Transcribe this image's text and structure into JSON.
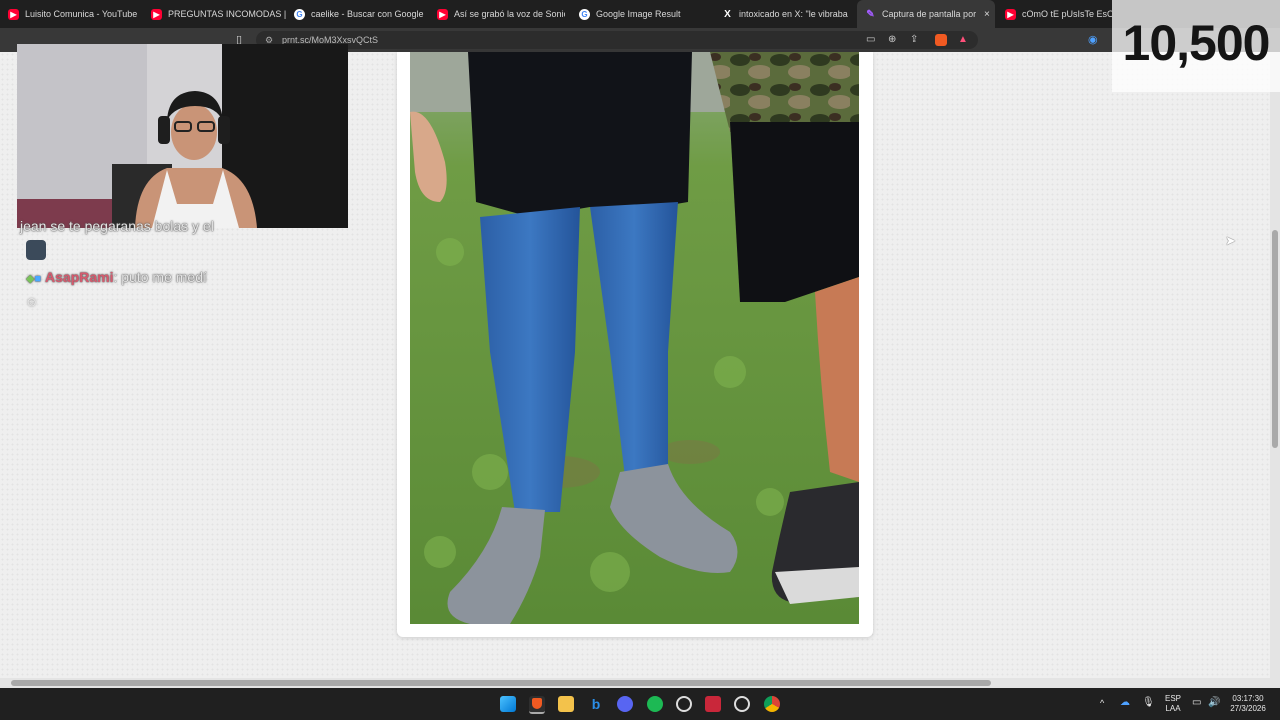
{
  "tabs": [
    {
      "title": "Luisito Comunica - YouTube",
      "icon": "youtube-icon",
      "color": "#ff0033"
    },
    {
      "title": "PREGUNTAS INCOMODAS | De",
      "icon": "youtube-icon",
      "color": "#ff0033"
    },
    {
      "title": "caelike - Buscar con Google",
      "icon": "google-icon",
      "color": "#ffffff"
    },
    {
      "title": "Así se grabó la voz de Sonic pa",
      "icon": "youtube-icon",
      "color": "#ff0033"
    },
    {
      "title": "Google Image Result",
      "icon": "google-icon",
      "color": "#ffffff"
    },
    {
      "title": "intoxicado en X: \"le vibraba un",
      "icon": "x-icon",
      "color": "#000000"
    },
    {
      "title": "Captura de pantalla por Li",
      "icon": "feather-icon",
      "color": "#a35cff"
    },
    {
      "title": "cOmO tE pUsIsTe EsOs Je",
      "icon": "youtube-icon",
      "color": "#ff0033"
    }
  ],
  "tab_close_glyph": "×",
  "address_bar": {
    "url": "prnt.sc/MoM3XxsvQCtS"
  },
  "counter": {
    "value": "10,500"
  },
  "chat": {
    "line1_text": "jean se te pegaranas bolas y el",
    "line2_user": "AsapRami",
    "line2_text": ": puto me medí"
  },
  "tray": {
    "lang_top": "ESP",
    "lang_bottom": "LAA",
    "time": "03:17:30",
    "date": "27/3/2026"
  },
  "colors": {
    "accent": "#a35cff",
    "chat_user": "#d65a6e"
  }
}
